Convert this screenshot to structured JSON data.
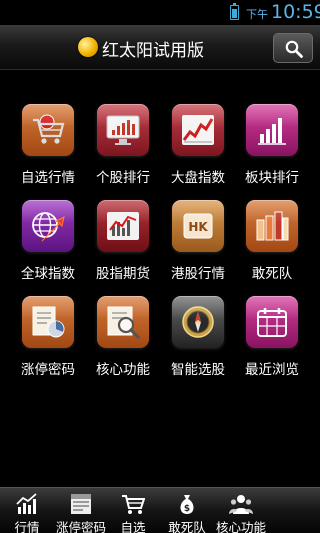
{
  "status_bar": {
    "ampm": "下午",
    "time": "10:59"
  },
  "header": {
    "title": "红太阳试用版"
  },
  "grid": [
    {
      "label": "自选行情",
      "icon": "cart-icon",
      "color": "#c8612a"
    },
    {
      "label": "个股排行",
      "icon": "monitor-bar-chart-icon",
      "color": "#a82a35"
    },
    {
      "label": "大盘指数",
      "icon": "line-chart-icon",
      "color": "#a82a35"
    },
    {
      "label": "板块排行",
      "icon": "bar-chart-icon",
      "color": "#b3287f"
    },
    {
      "label": "全球指数",
      "icon": "globe-icon",
      "color": "#7d2aa3"
    },
    {
      "label": "股指期货",
      "icon": "futures-chart-icon",
      "color": "#9a2029"
    },
    {
      "label": "港股行情",
      "icon": "hk-icon",
      "color": "#c47b34"
    },
    {
      "label": "敢死队",
      "icon": "bars-3d-icon",
      "color": "#c6612a"
    },
    {
      "label": "涨停密码",
      "icon": "document-pie-icon",
      "color": "#c8612a"
    },
    {
      "label": "核心功能",
      "icon": "magnifier-report-icon",
      "color": "#c8612a"
    },
    {
      "label": "智能选股",
      "icon": "compass-icon",
      "color": "#444444"
    },
    {
      "label": "最近浏览",
      "icon": "calendar-icon",
      "color": "#b3287f"
    }
  ],
  "tabbar": [
    {
      "label": "行情",
      "icon": "chart-icon"
    },
    {
      "label": "涨停密码",
      "icon": "newspaper-icon"
    },
    {
      "label": "自选",
      "icon": "cart-icon"
    },
    {
      "label": "敢死队",
      "icon": "money-bag-icon"
    },
    {
      "label": "核心功能",
      "icon": "users-icon"
    }
  ]
}
